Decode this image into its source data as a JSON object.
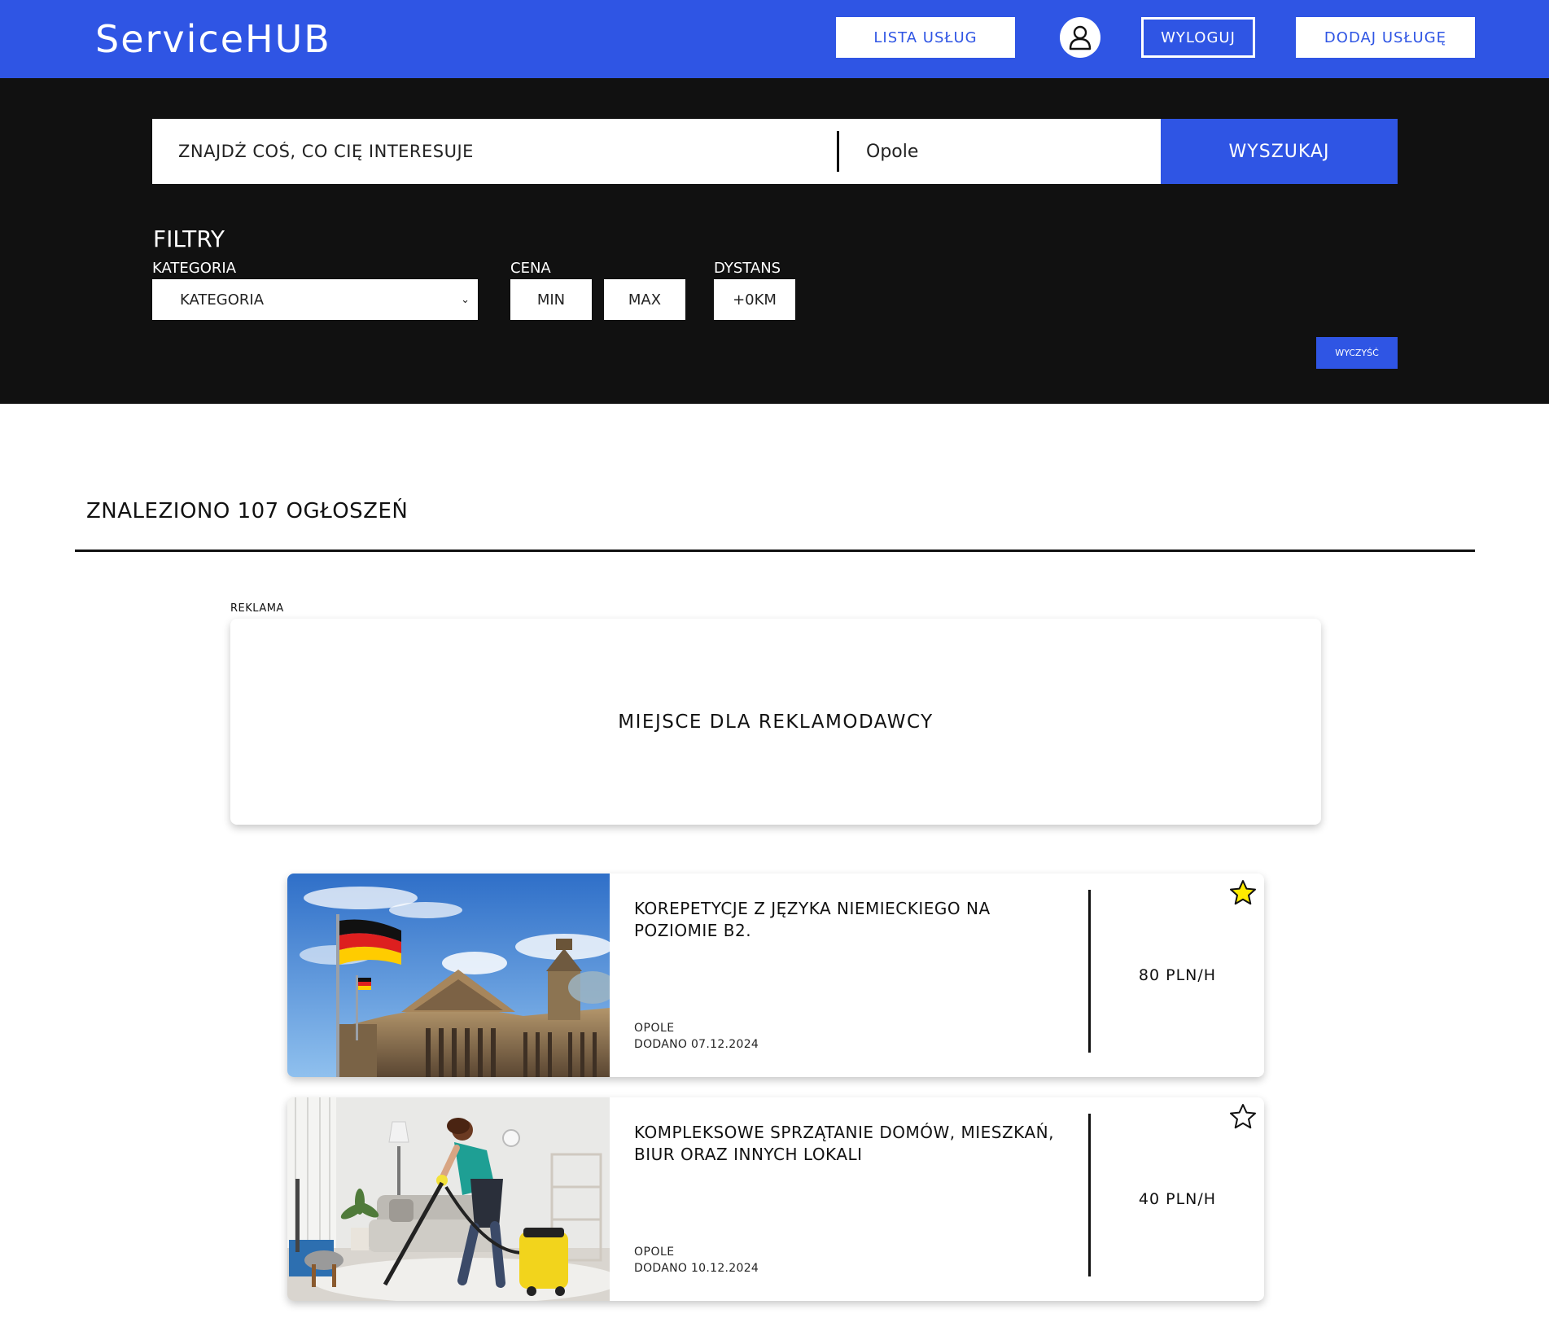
{
  "header": {
    "logo": "ServiceHUB",
    "nav_list": "LISTA USŁUG",
    "logout": "WYLOGUJ",
    "add_service": "DODAJ USŁUGĘ",
    "user_icon": "user-icon"
  },
  "search": {
    "query_placeholder": "ZNAJDŹ COŚ, CO CIĘ INTERESUJE",
    "location_value": "Opole",
    "button": "WYSZUKAJ"
  },
  "filters": {
    "title": "FILTRY",
    "category_label": "KATEGORIA",
    "category_value": "KATEGORIA",
    "price_label": "CENA",
    "price_min": "MIN",
    "price_max": "MAX",
    "distance_label": "DYSTANS",
    "distance_value": "+0KM",
    "clear": "WYCZYŚĆ"
  },
  "results": {
    "count_text": "ZNALEZIONO 107 OGŁOSZEŃ",
    "ad_label": "REKLAMA",
    "ad_text": "MIEJSCE DLA REKLAMODAWCY",
    "listings": [
      {
        "title": "KOREPETYCJE Z JĘZYKA NIEMIECKIEGO NA POZIOMIE B2.",
        "city": "OPOLE",
        "date": "DODANO 07.12.2024",
        "price": "80 PLN/H",
        "favorite": true,
        "image": "german-flag-reichstag"
      },
      {
        "title": "KOMPLEKSOWE SPRZĄTANIE DOMÓW, MIESZKAŃ, BIUR ORAZ INNYCH LOKALI",
        "city": "OPOLE",
        "date": "DODANO 10.12.2024",
        "price": "40 PLN/H",
        "favorite": false,
        "image": "woman-vacuuming-living-room"
      }
    ]
  },
  "colors": {
    "brand_blue": "#2f55e4",
    "dark_band": "#111111",
    "star_fill": "#ffeb00"
  }
}
